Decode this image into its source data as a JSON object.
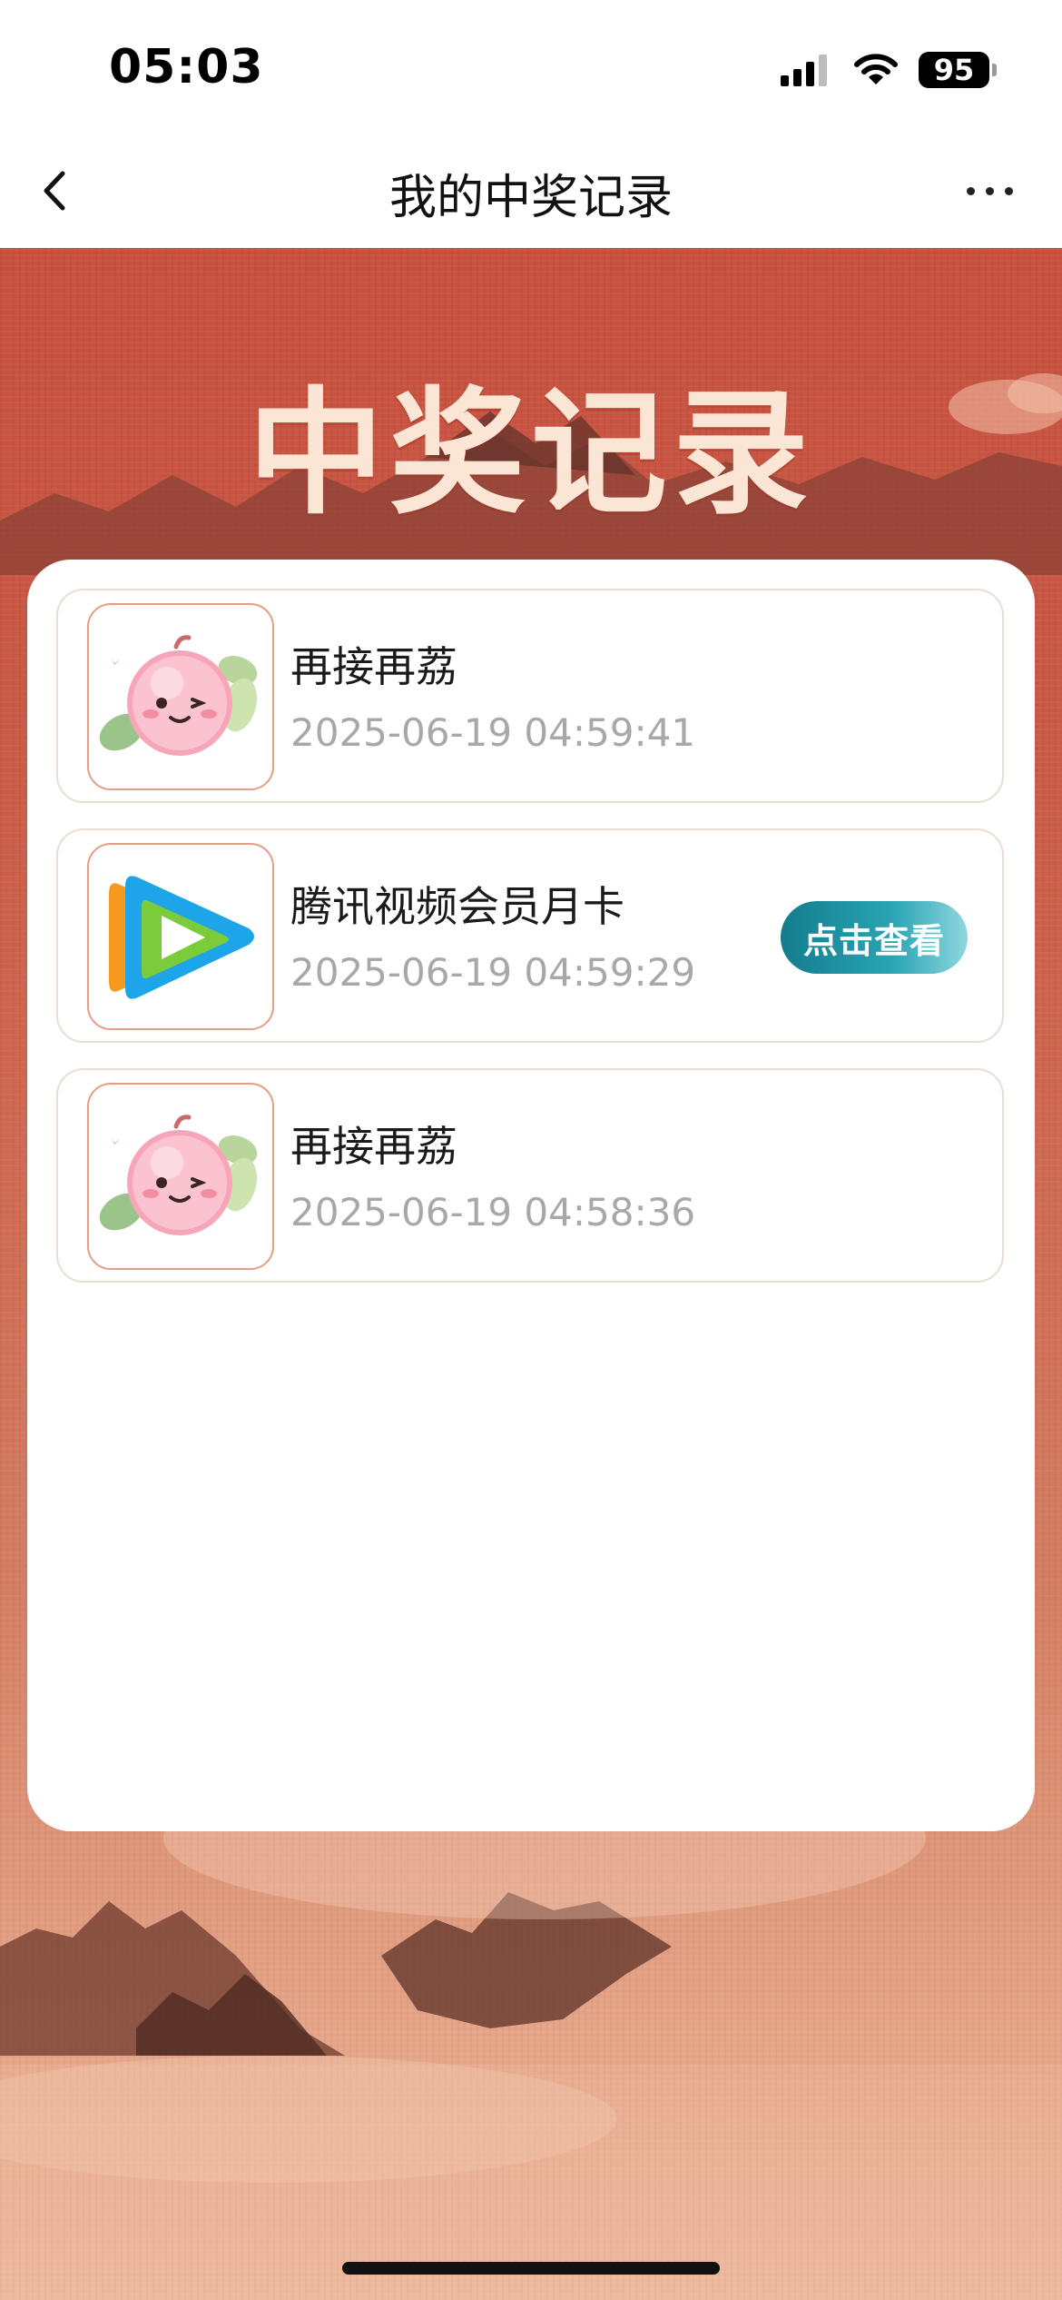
{
  "status_bar": {
    "time": "05:03",
    "battery": "95",
    "icons": [
      "cellular-signal-icon",
      "wifi-icon",
      "battery-icon"
    ]
  },
  "nav": {
    "title": "我的中奖记录",
    "icons": [
      "chevron-left-icon",
      "more-icon"
    ]
  },
  "banner": {
    "title": "中奖记录"
  },
  "records": [
    {
      "name": "再接再荔",
      "time": "2025-06-19 04:59:41",
      "icon": "lychee-mascot-icon"
    },
    {
      "name": "腾讯视频会员月卡",
      "time": "2025-06-19 04:59:29",
      "icon": "tencent-video-icon",
      "action_label": "点击查看"
    },
    {
      "name": "再接再荔",
      "time": "2025-06-19 04:58:36",
      "icon": "lychee-mascot-icon"
    }
  ],
  "colors": {
    "background_top": "#c8503f",
    "background_bottom": "#eeb79c",
    "banner_text": "#fbe6d5",
    "thumb_border": "#e59d86",
    "item_border": "#ecddd3",
    "timestamp": "#a8a8a8",
    "button_start": "#137d8d",
    "button_end": "#8fd7df"
  }
}
